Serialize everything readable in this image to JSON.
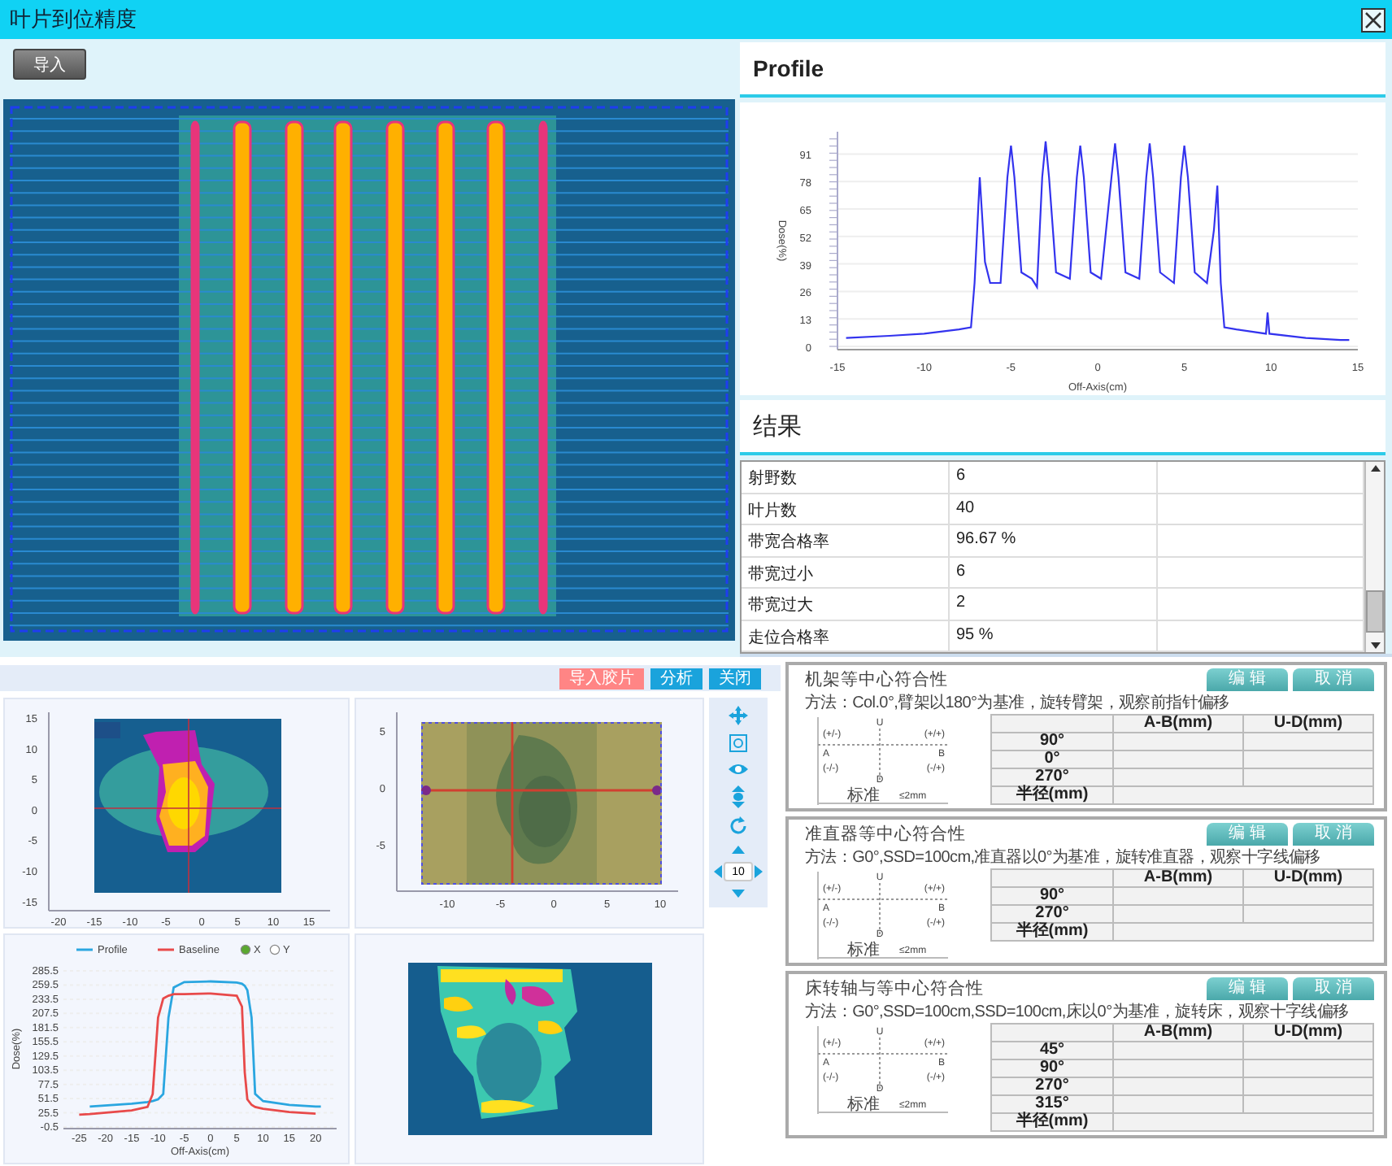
{
  "window": {
    "title": "叶片到位精度"
  },
  "leaf_panel": {
    "import_button": "导入"
  },
  "profile_panel": {
    "title": "Profile",
    "chart_data": {
      "type": "line",
      "xlabel": "Off-Axis(cm)",
      "ylabel": "Dose(%)",
      "xlim": [
        -15,
        15
      ],
      "ylim": [
        0,
        100
      ],
      "xticks": [
        -15,
        -10,
        -5,
        0,
        5,
        10,
        15
      ],
      "yticks": [
        0,
        13,
        26,
        39,
        52,
        65,
        78,
        91
      ],
      "x": [
        -14.5,
        -12,
        -10,
        -8,
        -7.3,
        -7.1,
        -6.8,
        -6.5,
        -6.2,
        -5.6,
        -5.2,
        -5,
        -4.8,
        -4.4,
        -3.8,
        -3.5,
        -3.2,
        -3,
        -2.8,
        -2.4,
        -1.6,
        -1.2,
        -1,
        -0.8,
        -0.4,
        0.2,
        0.8,
        1,
        1.2,
        1.6,
        2.4,
        2.8,
        3,
        3.2,
        3.6,
        4.4,
        4.8,
        5,
        5.2,
        5.6,
        6.3,
        6.7,
        6.9,
        7.1,
        7.3,
        8,
        9.7,
        9.8,
        9.9,
        12,
        14,
        14.5
      ],
      "grid": true,
      "series": [
        {
          "color": "#3333ee",
          "values": [
            4,
            5,
            6,
            8,
            9,
            30,
            80,
            40,
            30,
            30,
            80,
            95,
            80,
            35,
            32,
            28,
            80,
            97,
            80,
            35,
            32,
            80,
            95,
            80,
            35,
            32,
            80,
            96,
            80,
            35,
            32,
            80,
            96,
            80,
            35,
            30,
            80,
            95,
            80,
            35,
            30,
            55,
            76,
            30,
            9,
            8,
            6,
            16,
            6,
            4,
            3,
            3
          ]
        }
      ]
    }
  },
  "results_panel": {
    "title": "结果",
    "rows": [
      {
        "name": "射野数",
        "value": "6"
      },
      {
        "name": "叶片数",
        "value": "40"
      },
      {
        "name": "带宽合格率",
        "value": "96.67 %"
      },
      {
        "name": "带宽过小",
        "value": "6"
      },
      {
        "name": "带宽过大",
        "value": "2"
      },
      {
        "name": "走位合格率",
        "value": "95 %"
      }
    ]
  },
  "film_toolbar": {
    "buttons": [
      {
        "label": "导入胶片",
        "kind": "warning"
      },
      {
        "label": "分析",
        "kind": "primary"
      },
      {
        "label": "关闭",
        "kind": "primary"
      }
    ]
  },
  "dose_map": {
    "yticks": [
      "15",
      "10",
      "5",
      "0",
      "-5",
      "-10",
      "-15"
    ],
    "xticks": [
      "-20",
      "-15",
      "-10",
      "-5",
      "0",
      "5",
      "10",
      "15"
    ]
  },
  "film_map": {
    "yticks": [
      "5",
      "0",
      "-5"
    ],
    "xticks": [
      "-10",
      "-5",
      "0",
      "5",
      "10"
    ]
  },
  "tools": {
    "step": "10"
  },
  "profile_compare": {
    "axis_options": [
      {
        "label": "X",
        "selected": true
      },
      {
        "label": "Y",
        "selected": false
      }
    ],
    "chart_data": {
      "type": "line",
      "xlabel": "Off-Axis(cm)",
      "ylabel": "Dose(%)",
      "xlim": [
        -28,
        24
      ],
      "ylim": [
        -0.5,
        285.5
      ],
      "grid": true,
      "legend": "top",
      "xticks": [
        -25,
        -20,
        -15,
        -10,
        -5,
        0,
        5,
        10,
        15,
        20
      ],
      "yticks": [
        -0.5,
        25.5,
        51.5,
        77.5,
        103.5,
        129.5,
        155.5,
        181.5,
        207.5,
        233.5,
        259.5,
        285.5
      ],
      "x": [
        -25,
        -23,
        -15,
        -12,
        -11,
        -10,
        -9,
        -8,
        -7,
        -5,
        0,
        5,
        6,
        6.5,
        7,
        7.8,
        8.5,
        10,
        15,
        20,
        21
      ],
      "series": [
        {
          "name": "Profile",
          "color": "#2aa6e0",
          "values": [
            null,
            37,
            42,
            45,
            47,
            50,
            60,
            200,
            255,
            265,
            266,
            264,
            262,
            258,
            250,
            200,
            60,
            47,
            40,
            37,
            37
          ]
        },
        {
          "name": "Baseline",
          "color": "#e84a4a",
          "values": [
            22,
            23,
            30,
            36,
            60,
            200,
            235,
            240,
            243,
            243,
            244,
            240,
            220,
            100,
            50,
            40,
            36,
            33,
            27,
            24,
            null
          ]
        }
      ]
    }
  },
  "checks": [
    {
      "title": "机架等中心符合性",
      "method": "方法：Col.0°,臂架以180°为基准，旋转臂架，观察前指针偏移",
      "edit_button": "编 辑",
      "cancel_button": "取 消",
      "diagram": {
        "top": "U",
        "top_left": "(+/-)",
        "top_right": "(+/+)",
        "left": "A",
        "right": "B",
        "bottom_left": "(-/-)",
        "bottom_right": "(-/+)",
        "bottom": "D",
        "standard": "标准",
        "tolerance": "≤2mm"
      },
      "columns": [
        "A-B(mm)",
        "U-D(mm)"
      ],
      "rows": [
        "90°",
        "0°",
        "270°"
      ],
      "footer": "半径(mm)"
    },
    {
      "title": "准直器等中心符合性",
      "method": "方法：G0°,SSD=100cm,准直器以0°为基准，旋转准直器，观察十字线偏移",
      "edit_button": "编 辑",
      "cancel_button": "取 消",
      "diagram": {
        "top": "U",
        "top_left": "(+/-)",
        "top_right": "(+/+)",
        "left": "A",
        "right": "B",
        "bottom_left": "(-/-)",
        "bottom_right": "(-/+)",
        "bottom": "D",
        "standard": "标准",
        "tolerance": "≤2mm"
      },
      "columns": [
        "A-B(mm)",
        "U-D(mm)"
      ],
      "rows": [
        "90°",
        "270°"
      ],
      "footer": "半径(mm)"
    },
    {
      "title": "床转轴与等中心符合性",
      "method": "方法：G0°,SSD=100cm,SSD=100cm,床以0°为基准，旋转床，观察十字线偏移",
      "edit_button": "编 辑",
      "cancel_button": "取 消",
      "diagram": {
        "top": "U",
        "top_left": "(+/-)",
        "top_right": "(+/+)",
        "left": "A",
        "right": "B",
        "bottom_left": "(-/-)",
        "bottom_right": "(-/+)",
        "bottom": "D",
        "standard": "标准",
        "tolerance": "≤2mm"
      },
      "columns": [
        "A-B(mm)",
        "U-D(mm)"
      ],
      "rows": [
        "45°",
        "90°",
        "270°",
        "315°"
      ],
      "footer": "半径(mm)"
    }
  ]
}
